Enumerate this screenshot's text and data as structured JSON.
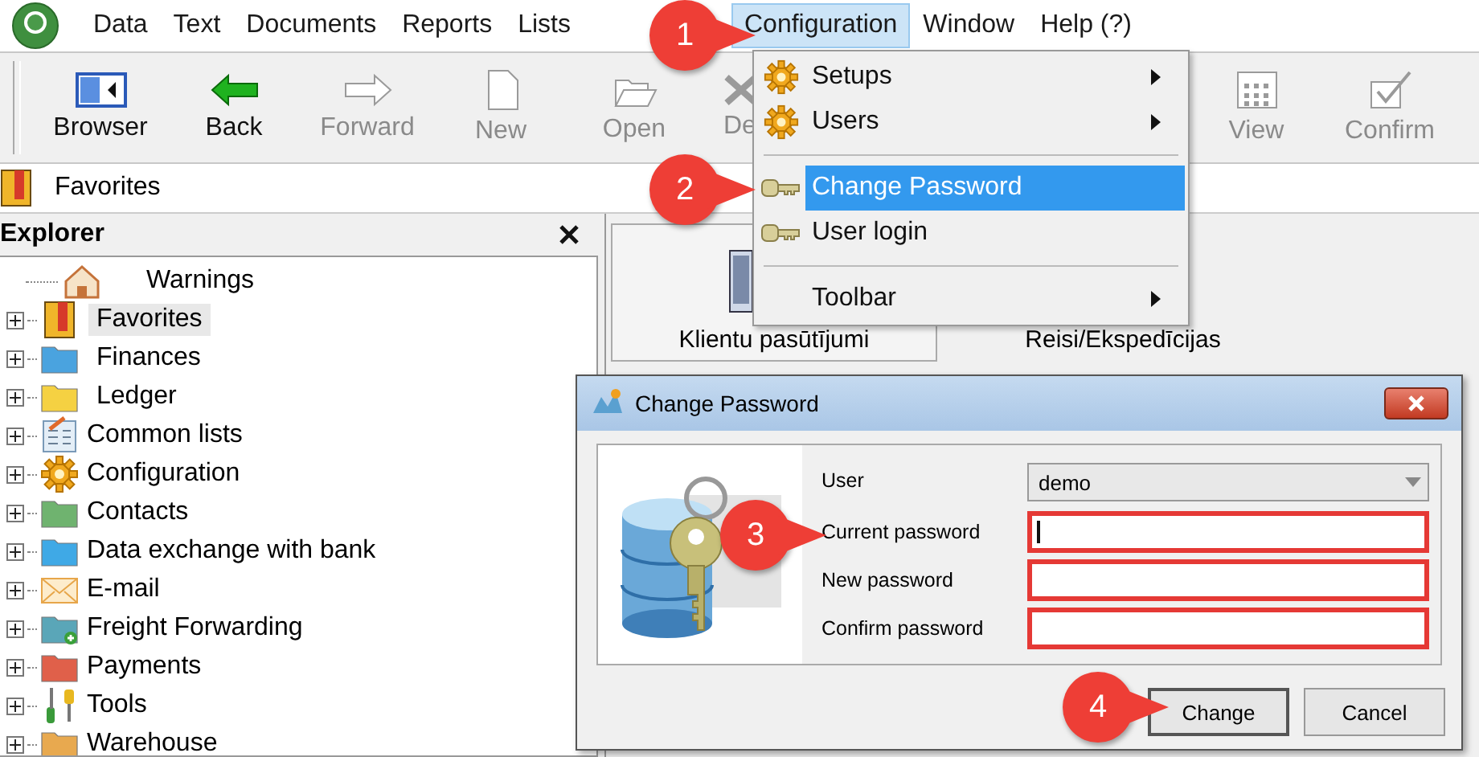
{
  "menu_bar": [
    {
      "label": "Data",
      "selected": false
    },
    {
      "label": "Text",
      "selected": false
    },
    {
      "label": "Documents",
      "selected": false
    },
    {
      "label": "Reports",
      "selected": false
    },
    {
      "label": "Lists",
      "selected": false
    },
    {
      "label": "Configuration",
      "selected": true
    },
    {
      "label": "Window",
      "selected": false
    },
    {
      "label": "Help (?)",
      "selected": false
    }
  ],
  "toolbar": [
    {
      "kind": "browser",
      "label": "Browser",
      "disabled": false
    },
    {
      "kind": "back",
      "label": "Back",
      "disabled": false
    },
    {
      "kind": "forward",
      "label": "Forward",
      "disabled": true
    },
    {
      "kind": "new",
      "label": "New",
      "disabled": true
    },
    {
      "kind": "open",
      "label": "Open",
      "disabled": true
    },
    {
      "kind": "delete",
      "label": "De",
      "disabled": true
    },
    {
      "kind": "view",
      "label": "View",
      "disabled": true
    },
    {
      "kind": "confirm",
      "label": "Confirm",
      "disabled": true
    }
  ],
  "favorites_bar": {
    "label": "Favorites"
  },
  "explorer": {
    "title": "Explorer",
    "items": [
      {
        "kind": "home",
        "label": "Warnings",
        "selected": false
      },
      {
        "kind": "bookmark",
        "label": "Favorites",
        "selected": true,
        "expanded": false
      },
      {
        "kind": "folder",
        "label": "Finances",
        "selected": false,
        "expanded": false,
        "color": "#4aa3df"
      },
      {
        "kind": "folder",
        "label": "Ledger",
        "selected": false,
        "expanded": false,
        "color": "#f5d142"
      },
      {
        "kind": "list",
        "label": "Common lists",
        "selected": false,
        "expanded": false
      },
      {
        "kind": "gear",
        "label": "Configuration",
        "selected": false,
        "expanded": false
      },
      {
        "kind": "folder",
        "label": "Contacts",
        "selected": false,
        "expanded": false,
        "color": "#6fb36f"
      },
      {
        "kind": "folder",
        "label": "Data exchange with bank",
        "selected": false,
        "expanded": false,
        "color": "#3fa9e6"
      },
      {
        "kind": "mail",
        "label": "E-mail",
        "selected": false,
        "expanded": false
      },
      {
        "kind": "folder-plus",
        "label": "Freight Forwarding",
        "selected": false,
        "expanded": false,
        "color": "#5aa6b8"
      },
      {
        "kind": "folder",
        "label": "Payments",
        "selected": false,
        "expanded": false,
        "color": "#e0604a"
      },
      {
        "kind": "tools",
        "label": "Tools",
        "selected": false,
        "expanded": false
      },
      {
        "kind": "folder",
        "label": "Warehouse",
        "selected": false,
        "expanded": false,
        "color": "#e8a94f"
      }
    ]
  },
  "content": {
    "tiles": [
      {
        "label": "Klientu pasūtījumi",
        "selected": true
      },
      {
        "label": "Reisi/Ekspedīcijas",
        "selected": false
      }
    ]
  },
  "dropdown_menu": [
    {
      "kind": "gear",
      "label": "Setups",
      "submenu": true,
      "selected": false
    },
    {
      "kind": "gear",
      "label": "Users",
      "submenu": true,
      "selected": false
    },
    {
      "kind": "separator"
    },
    {
      "kind": "key",
      "label": "Change Password",
      "submenu": false,
      "selected": true
    },
    {
      "kind": "key",
      "label": "User login",
      "submenu": false,
      "selected": false
    },
    {
      "kind": "separator"
    },
    {
      "kind": "plain",
      "label": "Toolbar",
      "submenu": true,
      "selected": false
    }
  ],
  "dialog": {
    "title": "Change Password",
    "fields": [
      {
        "kind": "combo",
        "label": "User",
        "value": "demo"
      },
      {
        "kind": "password",
        "label": "Current password",
        "focused": true,
        "highlighted": true
      },
      {
        "kind": "password",
        "label": "New password",
        "focused": false,
        "highlighted": true
      },
      {
        "kind": "password",
        "label": "Confirm password",
        "focused": false,
        "highlighted": true
      }
    ],
    "buttons": [
      {
        "label": "Change",
        "default": true
      },
      {
        "label": "Cancel",
        "default": false
      }
    ]
  },
  "callouts": [
    "1",
    "2",
    "3",
    "4"
  ]
}
